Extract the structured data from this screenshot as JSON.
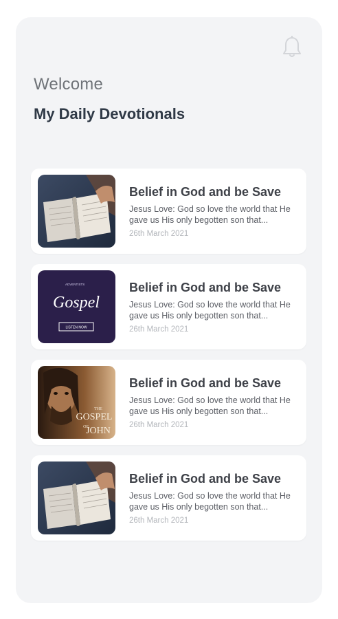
{
  "header": {
    "welcome": "Welcome",
    "title": "My Daily Devotionals",
    "notification_icon": "bell-icon"
  },
  "devotionals": [
    {
      "thumbnail": "bible-reading-image",
      "title": "Belief in God and be Save",
      "description": "Jesus Love: God so love the world that He gave us His only begotten son that...",
      "date": "26th March 2021"
    },
    {
      "thumbnail": "gospel-cover-image",
      "thumb_text": {
        "top": "ADVENTISTS",
        "main": "Gospel",
        "button": "LISTEN NOW"
      },
      "title": "Belief in God and be Save",
      "description": "Jesus Love: God so love the world that He gave us His only begotten son that...",
      "date": "26th March 2021"
    },
    {
      "thumbnail": "gospel-of-john-image",
      "thumb_text": {
        "the": "THE",
        "gospel": "GOSPEL",
        "of": "OF",
        "john": "JOHN"
      },
      "title": "Belief in God and be Save",
      "description": "Jesus Love: God so love the world that He gave us His only begotten son that...",
      "date": "26th March 2021"
    },
    {
      "thumbnail": "bible-reading-image",
      "title": "Belief in God and be Save",
      "description": "Jesus Love: God so love the world that He gave us His only begotten son that...",
      "date": "26th March 2021"
    }
  ],
  "colors": {
    "background": "#f3f4f6",
    "card": "#ffffff",
    "title": "#2f3946",
    "gospel_bg": "#2b1f4a"
  }
}
